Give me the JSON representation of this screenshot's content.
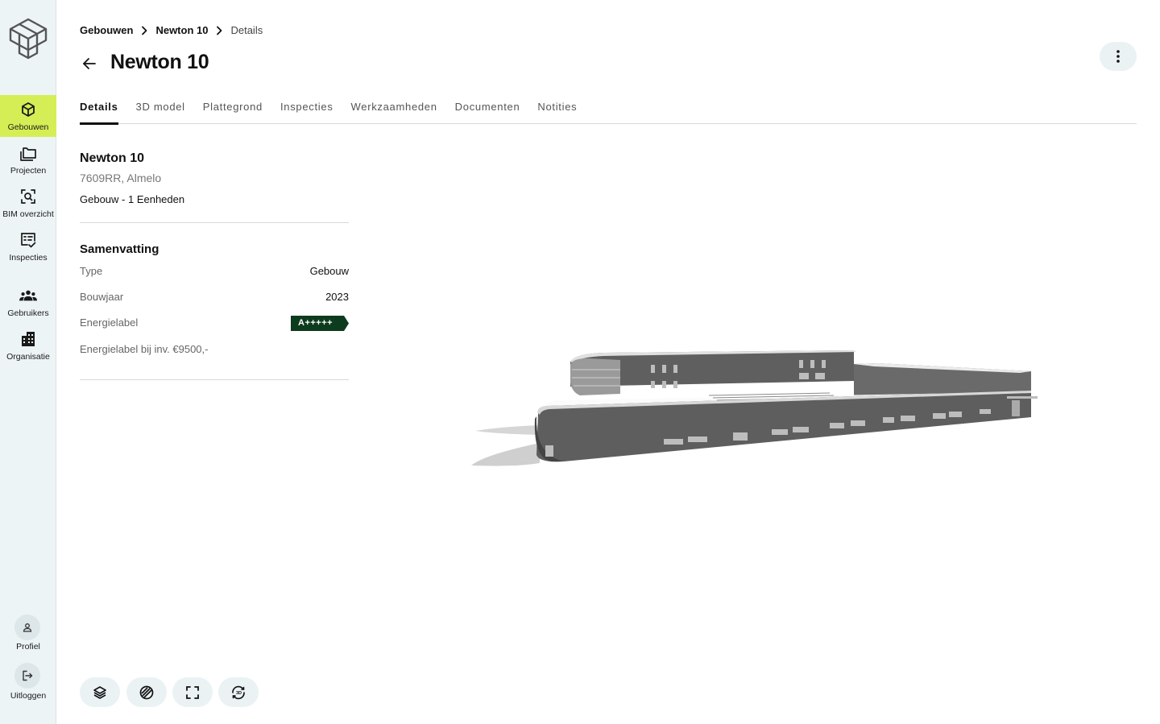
{
  "sidebar": {
    "logo": "logo-cube-icon",
    "items": [
      {
        "label": "Gebouwen",
        "icon": "cube-icon",
        "active": true
      },
      {
        "label": "Projecten",
        "icon": "folders-icon"
      },
      {
        "label": "BIM overzicht",
        "icon": "scan-search-icon"
      },
      {
        "label": "Inspecties",
        "icon": "checklist-icon"
      },
      {
        "label": "Gebruikers",
        "icon": "users-icon"
      },
      {
        "label": "Organisatie",
        "icon": "building-icon"
      }
    ],
    "profile_label": "Profiel",
    "logout_label": "Uitloggen",
    "accent_color": "#d6ee55"
  },
  "breadcrumb": {
    "items": [
      "Gebouwen",
      "Newton 10"
    ],
    "current": "Details"
  },
  "header": {
    "title": "Newton 10"
  },
  "tabs": [
    "Details",
    "3D model",
    "Plattegrond",
    "Inspecties",
    "Werkzaamheden",
    "Documenten",
    "Notities"
  ],
  "active_tab": "Details",
  "building": {
    "name": "Newton 10",
    "address": "7609RR, Almelo",
    "units": "Gebouw - 1 Eenheden"
  },
  "summary": {
    "title": "Samenvatting",
    "type_label": "Type",
    "type_value": "Gebouw",
    "year_label": "Bouwjaar",
    "year_value": "2023",
    "energy_label": "Energielabel",
    "energy_value": "A+++++",
    "energy_color": "#0d3b1e",
    "energy_inv_label": "Energielabel bij inv. €9500,-"
  },
  "toolbar": {
    "buttons": [
      "layers-icon",
      "xray-icon",
      "fullscreen-icon",
      "rotate-3d-icon"
    ]
  }
}
